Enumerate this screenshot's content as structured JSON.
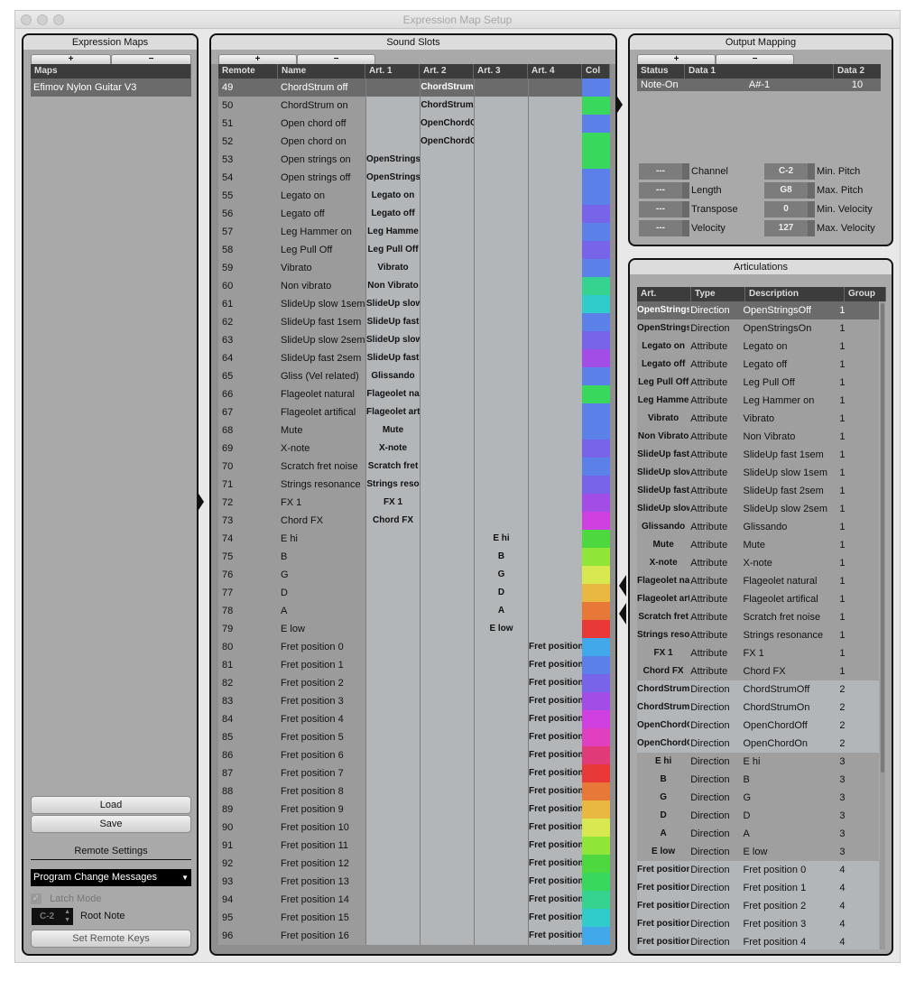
{
  "window": {
    "title": "Expression Map Setup"
  },
  "expression_maps": {
    "title": "Expression Maps",
    "add": "+",
    "remove": "−",
    "column": "Maps",
    "items": [
      "Efimov Nylon Guitar V3"
    ],
    "load": "Load",
    "save": "Save",
    "remote_settings": "Remote Settings",
    "remote_mode": "Program Change Messages",
    "latch_mode": "Latch Mode",
    "latch_checked": true,
    "root_note_value": "C-2",
    "root_note_label": "Root Note",
    "set_remote_keys": "Set Remote Keys"
  },
  "sound_slots": {
    "title": "Sound Slots",
    "add": "+",
    "remove": "−",
    "columns": [
      "Remote",
      "Name",
      "Art. 1",
      "Art. 2",
      "Art. 3",
      "Art. 4",
      "Col"
    ],
    "selected_index": 0,
    "rows": [
      [
        "49",
        "ChordStrum off",
        "",
        "ChordStrum",
        "",
        "",
        "#5b80e8"
      ],
      [
        "50",
        "ChordStrum on",
        "",
        "ChordStrum",
        "",
        "",
        "#37d85c"
      ],
      [
        "51",
        "Open chord off",
        "",
        "OpenChordOff",
        "",
        "",
        "#5b80e8"
      ],
      [
        "52",
        "Open chord on",
        "",
        "OpenChordOn",
        "",
        "",
        "#37d85c"
      ],
      [
        "53",
        "Open strings on",
        "OpenStrings",
        "",
        "",
        "",
        "#37d85c"
      ],
      [
        "54",
        "Open strings off",
        "OpenStrings",
        "",
        "",
        "",
        "#5b80e8"
      ],
      [
        "55",
        "Legato on",
        "Legato on",
        "",
        "",
        "",
        "#5b80e8"
      ],
      [
        "56",
        "Legato off",
        "Legato off",
        "",
        "",
        "",
        "#7764e8"
      ],
      [
        "57",
        "Leg Hammer on",
        "Leg Hamme",
        "",
        "",
        "",
        "#5b80e8"
      ],
      [
        "58",
        "Leg Pull Off",
        "Leg Pull Off",
        "",
        "",
        "",
        "#7764e8"
      ],
      [
        "59",
        "Vibrato",
        "Vibrato",
        "",
        "",
        "",
        "#5b80e8"
      ],
      [
        "60",
        "Non vibrato",
        "Non Vibrato",
        "",
        "",
        "",
        "#36d290"
      ],
      [
        "61",
        "SlideUp slow 1sem",
        "SlideUp slow",
        "",
        "",
        "",
        "#30cccc"
      ],
      [
        "62",
        "SlideUp fast 1sem",
        "SlideUp fast",
        "",
        "",
        "",
        "#5b80e8"
      ],
      [
        "63",
        "SlideUp slow 2sem",
        "SlideUp slow",
        "",
        "",
        "",
        "#7764e8"
      ],
      [
        "64",
        "SlideUp fast 2sem",
        "SlideUp fast",
        "",
        "",
        "",
        "#a24ee6"
      ],
      [
        "65",
        "Gliss (Vel related)",
        "Glissando",
        "",
        "",
        "",
        "#5b80e8"
      ],
      [
        "66",
        "Flageolet natural",
        "Flageolet na",
        "",
        "",
        "",
        "#37d85c"
      ],
      [
        "67",
        "Flageolet artifical",
        "Flageolet art",
        "",
        "",
        "",
        "#5b80e8"
      ],
      [
        "68",
        "Mute",
        "Mute",
        "",
        "",
        "",
        "#5b80e8"
      ],
      [
        "69",
        "X-note",
        "X-note",
        "",
        "",
        "",
        "#7764e8"
      ],
      [
        "70",
        "Scratch fret noise",
        "Scratch fret",
        "",
        "",
        "",
        "#5b80e8"
      ],
      [
        "71",
        "Strings resonance",
        "Strings reso",
        "",
        "",
        "",
        "#7764e8"
      ],
      [
        "72",
        "FX 1",
        "FX 1",
        "",
        "",
        "",
        "#a24ee6"
      ],
      [
        "73",
        "Chord FX",
        "Chord FX",
        "",
        "",
        "",
        "#d040e0"
      ],
      [
        "74",
        "E hi",
        "",
        "",
        "E hi",
        "",
        "#4ed840"
      ],
      [
        "75",
        "B",
        "",
        "",
        "B",
        "",
        "#90e638"
      ],
      [
        "76",
        "G",
        "",
        "",
        "G",
        "",
        "#d8e850"
      ],
      [
        "77",
        "D",
        "",
        "",
        "D",
        "",
        "#e8b840"
      ],
      [
        "78",
        "A",
        "",
        "",
        "A",
        "",
        "#e87838"
      ],
      [
        "79",
        "E low",
        "",
        "",
        "E low",
        "",
        "#e83838"
      ],
      [
        "80",
        "Fret position 0",
        "",
        "",
        "",
        "Fret position",
        "#42a8ea"
      ],
      [
        "81",
        "Fret position 1",
        "",
        "",
        "",
        "Fret position",
        "#5b80e8"
      ],
      [
        "82",
        "Fret position 2",
        "",
        "",
        "",
        "Fret position",
        "#7764e8"
      ],
      [
        "83",
        "Fret position 3",
        "",
        "",
        "",
        "Fret position",
        "#a24ee6"
      ],
      [
        "84",
        "Fret position 4",
        "",
        "",
        "",
        "Fret position",
        "#d040e0"
      ],
      [
        "85",
        "Fret position 5",
        "",
        "",
        "",
        "Fret position",
        "#e040c0"
      ],
      [
        "86",
        "Fret position 6",
        "",
        "",
        "",
        "Fret position",
        "#e03a78"
      ],
      [
        "87",
        "Fret position 7",
        "",
        "",
        "",
        "Fret position",
        "#e83838"
      ],
      [
        "88",
        "Fret position 8",
        "",
        "",
        "",
        "Fret position",
        "#e87838"
      ],
      [
        "89",
        "Fret position 9",
        "",
        "",
        "",
        "Fret position",
        "#e8b840"
      ],
      [
        "90",
        "Fret position 10",
        "",
        "",
        "",
        "Fret position",
        "#d8e850"
      ],
      [
        "91",
        "Fret position 11",
        "",
        "",
        "",
        "Fret position",
        "#90e638"
      ],
      [
        "92",
        "Fret position 12",
        "",
        "",
        "",
        "Fret position",
        "#4ed840"
      ],
      [
        "93",
        "Fret position 13",
        "",
        "",
        "",
        "Fret position",
        "#37d85c"
      ],
      [
        "94",
        "Fret position 14",
        "",
        "",
        "",
        "Fret position",
        "#36d290"
      ],
      [
        "95",
        "Fret position 15",
        "",
        "",
        "",
        "Fret position",
        "#30cccc"
      ],
      [
        "96",
        "Fret position 16",
        "",
        "",
        "",
        "Fret position",
        "#42a8ea"
      ]
    ]
  },
  "output_mapping": {
    "title": "Output Mapping",
    "add": "+",
    "remove": "−",
    "columns": [
      "Status",
      "Data 1",
      "Data 2"
    ],
    "rows": [
      [
        "Note-On",
        "A#-1",
        "10"
      ]
    ],
    "left_fields": [
      {
        "value": "---",
        "label": "Channel"
      },
      {
        "value": "---",
        "label": "Length"
      },
      {
        "value": "---",
        "label": "Transpose"
      },
      {
        "value": "---",
        "label": "Velocity"
      }
    ],
    "right_fields": [
      {
        "value": "C-2",
        "label": "Min. Pitch"
      },
      {
        "value": "G8",
        "label": "Max. Pitch"
      },
      {
        "value": "0",
        "label": "Min. Velocity"
      },
      {
        "value": "127",
        "label": "Max. Velocity"
      }
    ]
  },
  "articulations": {
    "title": "Articulations",
    "columns": [
      "Art.",
      "Type",
      "Description",
      "Group"
    ],
    "selected_index": 0,
    "rows": [
      [
        "OpenStrings",
        "Direction",
        "OpenStringsOff",
        "1"
      ],
      [
        "OpenStrings",
        "Direction",
        "OpenStringsOn",
        "1"
      ],
      [
        "Legato on",
        "Attribute",
        "Legato on",
        "1"
      ],
      [
        "Legato off",
        "Attribute",
        "Legato off",
        "1"
      ],
      [
        "Leg Pull Off",
        "Attribute",
        "Leg Pull Off",
        "1"
      ],
      [
        "Leg Hamme",
        "Attribute",
        "Leg Hammer on",
        "1"
      ],
      [
        "Vibrato",
        "Attribute",
        "Vibrato",
        "1"
      ],
      [
        "Non Vibrato",
        "Attribute",
        "Non Vibrato",
        "1"
      ],
      [
        "SlideUp fast",
        "Attribute",
        "SlideUp fast 1sem",
        "1"
      ],
      [
        "SlideUp slow",
        "Attribute",
        "SlideUp slow 1sem",
        "1"
      ],
      [
        "SlideUp fast",
        "Attribute",
        "SlideUp fast 2sem",
        "1"
      ],
      [
        "SlideUp slow",
        "Attribute",
        "SlideUp slow 2sem",
        "1"
      ],
      [
        "Glissando",
        "Attribute",
        "Glissando",
        "1"
      ],
      [
        "Mute",
        "Attribute",
        "Mute",
        "1"
      ],
      [
        "X-note",
        "Attribute",
        "X-note",
        "1"
      ],
      [
        "Flageolet na",
        "Attribute",
        "Flageolet natural",
        "1"
      ],
      [
        "Flageolet art",
        "Attribute",
        "Flageolet artifical",
        "1"
      ],
      [
        "Scratch fret",
        "Attribute",
        "Scratch fret noise",
        "1"
      ],
      [
        "Strings reso",
        "Attribute",
        "Strings resonance",
        "1"
      ],
      [
        "FX 1",
        "Attribute",
        "FX 1",
        "1"
      ],
      [
        "Chord FX",
        "Attribute",
        "Chord FX",
        "1"
      ],
      [
        "ChordStrum",
        "Direction",
        "ChordStrumOff",
        "2"
      ],
      [
        "ChordStrum",
        "Direction",
        "ChordStrumOn",
        "2"
      ],
      [
        "OpenChordO",
        "Direction",
        "OpenChordOff",
        "2"
      ],
      [
        "OpenChordO",
        "Direction",
        "OpenChordOn",
        "2"
      ],
      [
        "E hi",
        "Direction",
        "E hi",
        "3"
      ],
      [
        "B",
        "Direction",
        "B",
        "3"
      ],
      [
        "G",
        "Direction",
        "G",
        "3"
      ],
      [
        "D",
        "Direction",
        "D",
        "3"
      ],
      [
        "A",
        "Direction",
        "A",
        "3"
      ],
      [
        "E low",
        "Direction",
        "E low",
        "3"
      ],
      [
        "Fret position",
        "Direction",
        "Fret position 0",
        "4"
      ],
      [
        "Fret position",
        "Direction",
        "Fret position 1",
        "4"
      ],
      [
        "Fret position",
        "Direction",
        "Fret position 2",
        "4"
      ],
      [
        "Fret position",
        "Direction",
        "Fret position 3",
        "4"
      ],
      [
        "Fret position",
        "Direction",
        "Fret position 4",
        "4"
      ]
    ]
  }
}
